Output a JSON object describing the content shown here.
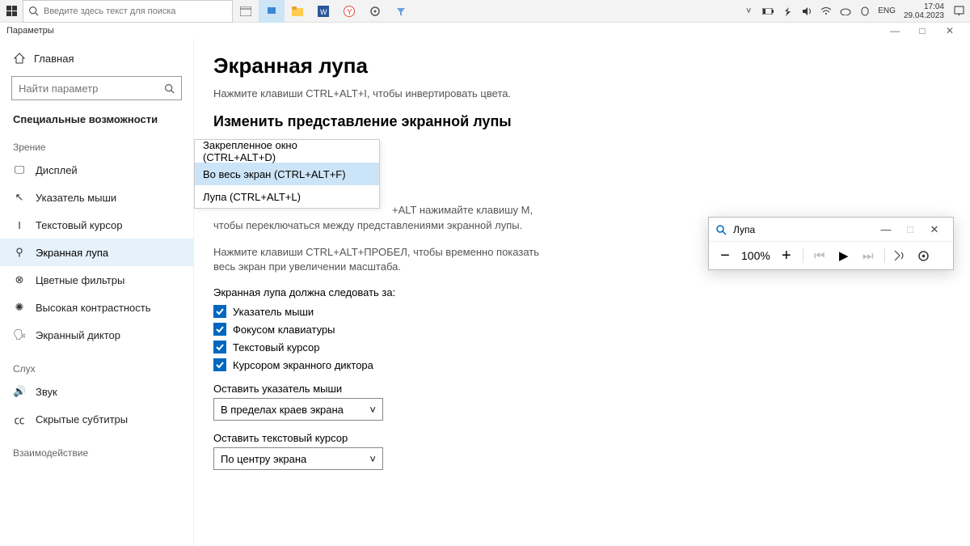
{
  "taskbar": {
    "search_placeholder": "Введите здесь текст для поиска",
    "lang": "ENG",
    "time": "17:04",
    "date": "29.04.2023"
  },
  "titlebar": {
    "app": "Параметры"
  },
  "sidebar": {
    "home": "Главная",
    "search_placeholder": "Найти параметр",
    "category": "Специальные возможности",
    "groups": {
      "vision": "Зрение",
      "hearing": "Слух",
      "interaction": "Взаимодействие"
    },
    "items": {
      "display": "Дисплей",
      "pointer": "Указатель мыши",
      "textcursor": "Текстовый курсор",
      "magnifier": "Экранная лупа",
      "colorfilters": "Цветные фильтры",
      "highcontrast": "Высокая контрастность",
      "narrator": "Экранный диктор",
      "sound": "Звук",
      "captions": "Скрытые субтитры"
    }
  },
  "content": {
    "h1": "Экранная лупа",
    "p1": "Нажмите клавиши CTRL+ALT+I, чтобы инвертировать цвета.",
    "h2": "Изменить представление экранной лупы",
    "dropdown": {
      "opt0": "Закрепленное окно (CTRL+ALT+D)",
      "opt1": "Во весь экран (CTRL+ALT+F)",
      "opt2": "Лупа (CTRL+ALT+L)"
    },
    "p2": "+ALT нажимайте клавишу M, чтобы переключаться между представлениями экранной лупы.",
    "p3": "Нажмите клавиши CTRL+ALT+ПРОБЕЛ, чтобы временно показать весь экран при увеличении масштаба.",
    "follow_label": "Экранная лупа должна следовать за:",
    "follow": {
      "mouse": "Указатель мыши",
      "keyboard": "Фокусом клавиатуры",
      "textcursor": "Текстовый курсор",
      "narrator": "Курсором экранного диктора"
    },
    "keep_mouse_label": "Оставить указатель мыши",
    "keep_mouse_val": "В пределах краев экрана",
    "keep_cursor_label": "Оставить текстовый курсор",
    "keep_cursor_val": "По центру экрана"
  },
  "magnifier_tool": {
    "title": "Лупа",
    "zoom": "100%"
  }
}
